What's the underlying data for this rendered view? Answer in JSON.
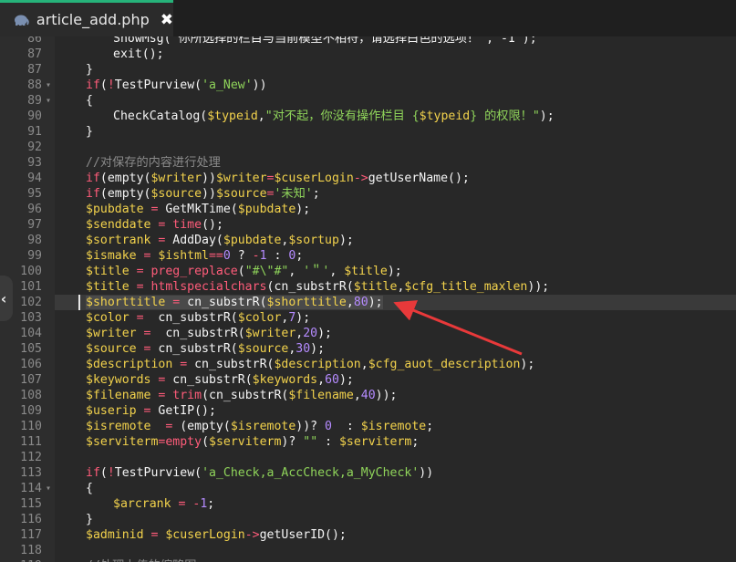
{
  "tab": {
    "title": "article_add.php",
    "icon": "php-elephant-icon",
    "close_glyph": "✖"
  },
  "side_toggle": {
    "glyph": "‹"
  },
  "colors": {
    "accent": "#26b37a",
    "arrow": "#e8393a",
    "keyword": "#ff5c7a",
    "variable": "#f2d24c",
    "string": "#8fd45a",
    "number": "#b58bff"
  },
  "editor": {
    "active_line": "102",
    "lines": [
      {
        "n": "86",
        "fold": "",
        "t": [
          [
            "fn",
            "ShowMsg(\"你所选择的栏目与当前模型不相符，请选择白色的选项！\",\"-1\");"
          ]
        ],
        "indent": 30,
        "partial": true
      },
      {
        "n": "87",
        "fold": "",
        "t": [
          [
            "fn",
            "exit();"
          ]
        ],
        "indent": 30
      },
      {
        "n": "87",
        "fold": "",
        "t": [
          [
            "fn",
            "}"
          ]
        ],
        "indent": 0
      },
      {
        "n": "88",
        "fold": "▾",
        "t": [
          [
            "kw",
            "if"
          ],
          [
            "fn",
            "("
          ],
          [
            "op",
            "!"
          ],
          [
            "fn",
            "TestPurview("
          ],
          [
            "str",
            "'a_New'"
          ],
          [
            "fn",
            "))"
          ]
        ],
        "indent": 0
      },
      {
        "n": "89",
        "fold": "▾",
        "t": [
          [
            "fn",
            "{"
          ]
        ],
        "indent": 0
      },
      {
        "n": "90",
        "fold": "",
        "t": [
          [
            "fn",
            "CheckCatalog("
          ],
          [
            "var",
            "$typeid"
          ],
          [
            "fn",
            ","
          ],
          [
            "str",
            "\"对不起，你没有操作栏目 {"
          ],
          [
            "var",
            "$typeid"
          ],
          [
            "str",
            "} 的权限！\""
          ],
          [
            "fn",
            ");"
          ]
        ],
        "indent": 30
      },
      {
        "n": "91",
        "fold": "",
        "t": [
          [
            "fn",
            "}"
          ]
        ],
        "indent": 0
      },
      {
        "n": "92",
        "fold": "",
        "t": [],
        "indent": 0
      },
      {
        "n": "93",
        "fold": "",
        "t": [
          [
            "com",
            "//对保存的内容进行处理"
          ]
        ],
        "indent": 0
      },
      {
        "n": "94",
        "fold": "",
        "t": [
          [
            "kw",
            "if"
          ],
          [
            "fn",
            "(empty("
          ],
          [
            "var",
            "$writer"
          ],
          [
            "fn",
            "))"
          ],
          [
            "var",
            "$writer"
          ],
          [
            "op",
            "="
          ],
          [
            "var",
            "$cuserLogin"
          ],
          [
            "op",
            "->"
          ],
          [
            "fn",
            "getUserName();"
          ]
        ],
        "indent": 0
      },
      {
        "n": "95",
        "fold": "",
        "t": [
          [
            "kw",
            "if"
          ],
          [
            "fn",
            "(empty("
          ],
          [
            "var",
            "$source"
          ],
          [
            "fn",
            "))"
          ],
          [
            "var",
            "$source"
          ],
          [
            "op",
            "="
          ],
          [
            "str",
            "'未知'"
          ],
          [
            "fn",
            ";"
          ]
        ],
        "indent": 0
      },
      {
        "n": "96",
        "fold": "",
        "t": [
          [
            "var",
            "$pubdate"
          ],
          [
            "op",
            " = "
          ],
          [
            "fn",
            "GetMkTime("
          ],
          [
            "var",
            "$pubdate"
          ],
          [
            "fn",
            ");"
          ]
        ],
        "indent": 0
      },
      {
        "n": "97",
        "fold": "",
        "t": [
          [
            "var",
            "$senddate"
          ],
          [
            "op",
            " = "
          ],
          [
            "kw",
            "time"
          ],
          [
            "fn",
            "();"
          ]
        ],
        "indent": 0
      },
      {
        "n": "98",
        "fold": "",
        "t": [
          [
            "var",
            "$sortrank"
          ],
          [
            "op",
            " = "
          ],
          [
            "fn",
            "AddDay("
          ],
          [
            "var",
            "$pubdate"
          ],
          [
            "fn",
            ","
          ],
          [
            "var",
            "$sortup"
          ],
          [
            "fn",
            ");"
          ]
        ],
        "indent": 0
      },
      {
        "n": "99",
        "fold": "",
        "t": [
          [
            "var",
            "$ismake"
          ],
          [
            "op",
            " = "
          ],
          [
            "var",
            "$ishtml"
          ],
          [
            "op",
            "=="
          ],
          [
            "num",
            "0"
          ],
          [
            "fn",
            " ? "
          ],
          [
            "op",
            "-"
          ],
          [
            "num",
            "1"
          ],
          [
            "fn",
            " : "
          ],
          [
            "num",
            "0"
          ],
          [
            "fn",
            ";"
          ]
        ],
        "indent": 0
      },
      {
        "n": "100",
        "fold": "",
        "t": [
          [
            "var",
            "$title"
          ],
          [
            "op",
            " = "
          ],
          [
            "kw",
            "preg_replace"
          ],
          [
            "fn",
            "("
          ],
          [
            "str",
            "\"#\\\"#\""
          ],
          [
            "fn",
            ", "
          ],
          [
            "str",
            "'＂'"
          ],
          [
            "fn",
            ", "
          ],
          [
            "var",
            "$title"
          ],
          [
            "fn",
            ");"
          ]
        ],
        "indent": 0
      },
      {
        "n": "101",
        "fold": "",
        "t": [
          [
            "var",
            "$title"
          ],
          [
            "op",
            " = "
          ],
          [
            "kw",
            "htmlspecialchars"
          ],
          [
            "fn",
            "(cn_substrR("
          ],
          [
            "var",
            "$title"
          ],
          [
            "fn",
            ","
          ],
          [
            "var",
            "$cfg_title_maxlen"
          ],
          [
            "fn",
            "));"
          ]
        ],
        "indent": 0
      },
      {
        "n": "102",
        "fold": "",
        "t": [
          [
            "var hl",
            "$shorttitle"
          ],
          [
            "op hl",
            " = "
          ],
          [
            "fn hl",
            "cn_substrR("
          ],
          [
            "var hl",
            "$shorttitle"
          ],
          [
            "fn hl",
            ","
          ],
          [
            "hlnum",
            "80"
          ],
          [
            "fn hl",
            ");"
          ]
        ],
        "indent": 0,
        "active": true
      },
      {
        "n": "103",
        "fold": "",
        "t": [
          [
            "var",
            "$color"
          ],
          [
            "op",
            " =  "
          ],
          [
            "fn",
            "cn_substrR("
          ],
          [
            "var",
            "$color"
          ],
          [
            "fn",
            ","
          ],
          [
            "num",
            "7"
          ],
          [
            "fn",
            ");"
          ]
        ],
        "indent": 0
      },
      {
        "n": "104",
        "fold": "",
        "t": [
          [
            "var",
            "$writer"
          ],
          [
            "op",
            " =  "
          ],
          [
            "fn",
            "cn_substrR("
          ],
          [
            "var",
            "$writer"
          ],
          [
            "fn",
            ","
          ],
          [
            "num",
            "20"
          ],
          [
            "fn",
            ");"
          ]
        ],
        "indent": 0
      },
      {
        "n": "105",
        "fold": "",
        "t": [
          [
            "var",
            "$source"
          ],
          [
            "op",
            " = "
          ],
          [
            "fn",
            "cn_substrR("
          ],
          [
            "var",
            "$source"
          ],
          [
            "fn",
            ","
          ],
          [
            "num",
            "30"
          ],
          [
            "fn",
            ");"
          ]
        ],
        "indent": 0
      },
      {
        "n": "106",
        "fold": "",
        "t": [
          [
            "var",
            "$description"
          ],
          [
            "op",
            " = "
          ],
          [
            "fn",
            "cn_substrR("
          ],
          [
            "var",
            "$description"
          ],
          [
            "fn",
            ","
          ],
          [
            "var",
            "$cfg_auot_description"
          ],
          [
            "fn",
            ");"
          ]
        ],
        "indent": 0
      },
      {
        "n": "107",
        "fold": "",
        "t": [
          [
            "var",
            "$keywords"
          ],
          [
            "op",
            " = "
          ],
          [
            "fn",
            "cn_substrR("
          ],
          [
            "var",
            "$keywords"
          ],
          [
            "fn",
            ","
          ],
          [
            "num",
            "60"
          ],
          [
            "fn",
            ");"
          ]
        ],
        "indent": 0
      },
      {
        "n": "108",
        "fold": "",
        "t": [
          [
            "var",
            "$filename"
          ],
          [
            "op",
            " = "
          ],
          [
            "kw",
            "trim"
          ],
          [
            "fn",
            "(cn_substrR("
          ],
          [
            "var",
            "$filename"
          ],
          [
            "fn",
            ","
          ],
          [
            "num",
            "40"
          ],
          [
            "fn",
            "));"
          ]
        ],
        "indent": 0
      },
      {
        "n": "109",
        "fold": "",
        "t": [
          [
            "var",
            "$userip"
          ],
          [
            "op",
            " = "
          ],
          [
            "fn",
            "GetIP();"
          ]
        ],
        "indent": 0
      },
      {
        "n": "110",
        "fold": "",
        "t": [
          [
            "var",
            "$isremote"
          ],
          [
            "op",
            "  = "
          ],
          [
            "fn",
            "(empty("
          ],
          [
            "var",
            "$isremote"
          ],
          [
            "fn",
            "))? "
          ],
          [
            "num",
            "0"
          ],
          [
            "fn",
            "  : "
          ],
          [
            "var",
            "$isremote"
          ],
          [
            "fn",
            ";"
          ]
        ],
        "indent": 0
      },
      {
        "n": "111",
        "fold": "",
        "t": [
          [
            "var",
            "$serviterm"
          ],
          [
            "op",
            "="
          ],
          [
            "kw",
            "empty"
          ],
          [
            "fn",
            "("
          ],
          [
            "var",
            "$serviterm"
          ],
          [
            "fn",
            ")? "
          ],
          [
            "str",
            "\"\""
          ],
          [
            "fn",
            " : "
          ],
          [
            "var",
            "$serviterm"
          ],
          [
            "fn",
            ";"
          ]
        ],
        "indent": 0
      },
      {
        "n": "112",
        "fold": "",
        "t": [],
        "indent": 0
      },
      {
        "n": "113",
        "fold": "",
        "t": [
          [
            "kw",
            "if"
          ],
          [
            "fn",
            "("
          ],
          [
            "op",
            "!"
          ],
          [
            "fn",
            "TestPurview("
          ],
          [
            "str",
            "'a_Check,a_AccCheck,a_MyCheck'"
          ],
          [
            "fn",
            "))"
          ]
        ],
        "indent": 0
      },
      {
        "n": "114",
        "fold": "▾",
        "t": [
          [
            "fn",
            "{"
          ]
        ],
        "indent": 0
      },
      {
        "n": "115",
        "fold": "",
        "t": [
          [
            "var",
            "$arcrank"
          ],
          [
            "op",
            " = "
          ],
          [
            "op",
            "-"
          ],
          [
            "num",
            "1"
          ],
          [
            "fn",
            ";"
          ]
        ],
        "indent": 30
      },
      {
        "n": "116",
        "fold": "",
        "t": [
          [
            "fn",
            "}"
          ]
        ],
        "indent": 0
      },
      {
        "n": "117",
        "fold": "",
        "t": [
          [
            "var",
            "$adminid"
          ],
          [
            "op",
            " = "
          ],
          [
            "var",
            "$cuserLogin"
          ],
          [
            "op",
            "->"
          ],
          [
            "fn",
            "getUserID();"
          ]
        ],
        "indent": 0
      },
      {
        "n": "118",
        "fold": "",
        "t": [],
        "indent": 0
      },
      {
        "n": "119",
        "fold": "",
        "t": [
          [
            "com",
            "//处理上传的缩略图"
          ]
        ],
        "indent": 0
      }
    ]
  }
}
